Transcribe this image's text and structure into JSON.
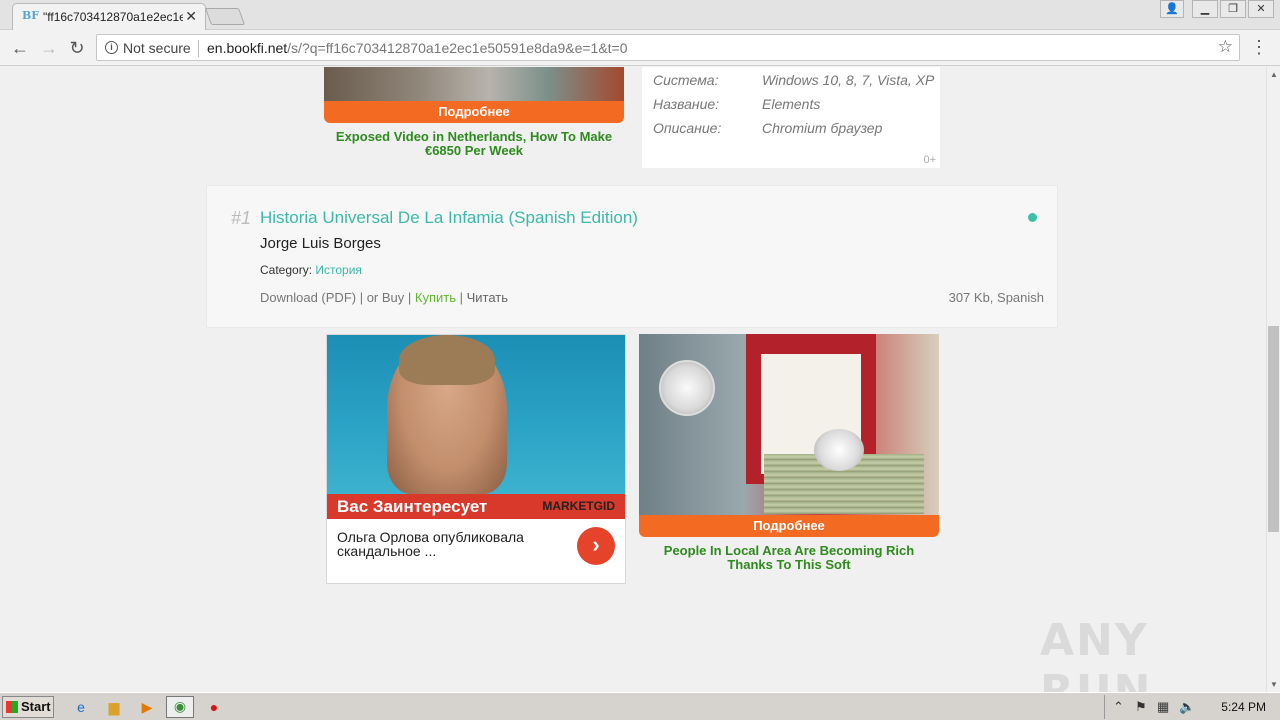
{
  "browser": {
    "tab_title": "\"ff16c703412870a1e2ec1e5",
    "tab_favicon": "BF",
    "not_secure": "Not secure",
    "url_host": "en.bookfi.net",
    "url_path": "/s/?q=ff16c703412870a1e2ec1e50591e8da9&e=1&t=0"
  },
  "ad_top_left": {
    "button": "Подробнее",
    "caption": "Exposed Video in Netherlands, How To Make €6850 Per Week"
  },
  "info_box": {
    "rows": [
      {
        "label": "Система:",
        "value": "Windows 10, 8, 7, Vista, XP"
      },
      {
        "label": "Название:",
        "value": "Elements"
      },
      {
        "label": "Описание:",
        "value": "Chromium браузер"
      }
    ],
    "age": "0+"
  },
  "result": {
    "rank": "#1",
    "title": "Historia Universal De La Infamia (Spanish Edition)",
    "author": "Jorge Luis Borges",
    "category_label": "Category:",
    "category": "История",
    "download": "Download (PDF)",
    "sep1": " | ",
    "or_buy": "or Buy",
    "sep2": " | ",
    "buy_ru": "Купить",
    "sep3": " | ",
    "read": "Читать",
    "size_lang": "307 Kb, Spanish"
  },
  "ad_bottom_left": {
    "banner": "Вас Заинтересует",
    "brand": "MARKETGID",
    "description": "Ольга Орлова опубликовала скандальное ..."
  },
  "ad_bottom_right": {
    "button": "Подробнее",
    "caption": "People In Local Area Are Becoming Rich Thanks To This Soft"
  },
  "watermark": "ANY RUN",
  "taskbar": {
    "start": "Start",
    "clock": "5:24 PM"
  }
}
